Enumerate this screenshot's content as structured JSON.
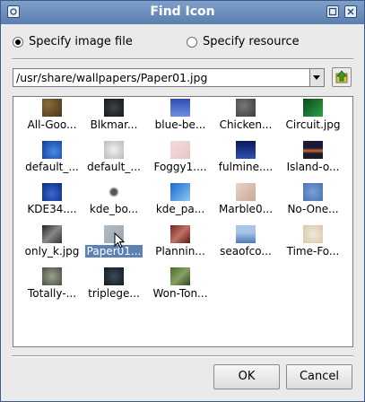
{
  "window": {
    "title": "Find Icon"
  },
  "source": {
    "file_label": "Specify image file",
    "resource_label": "Specify resource",
    "selected": "file"
  },
  "path": {
    "value": "/usr/share/wallpapers/Paper01.jpg"
  },
  "icons": [
    {
      "label": "All-Goo...",
      "thumb": "thumb-brown"
    },
    {
      "label": "Blkmar...",
      "thumb": "thumb-darkspeck"
    },
    {
      "label": "blue-be...",
      "thumb": "thumb-blue"
    },
    {
      "label": "Chicken...",
      "thumb": "thumb-greyrock"
    },
    {
      "label": "Circuit.jpg",
      "thumb": "thumb-circuit"
    },
    {
      "label": "default_...",
      "thumb": "thumb-default-blue"
    },
    {
      "label": "default_...",
      "thumb": "thumb-default-grey"
    },
    {
      "label": "Foggy1....",
      "thumb": "thumb-pink"
    },
    {
      "label": "fulmine....",
      "thumb": "thumb-navy"
    },
    {
      "label": "Island-o...",
      "thumb": "thumb-sunset"
    },
    {
      "label": "KDE34....",
      "thumb": "thumb-kde34"
    },
    {
      "label": "kde_bo...",
      "thumb": "thumb-kde-bo"
    },
    {
      "label": "kde_pa...",
      "thumb": "thumb-kde-pa"
    },
    {
      "label": "Marble0...",
      "thumb": "thumb-marble"
    },
    {
      "label": "No-One...",
      "thumb": "thumb-noone"
    },
    {
      "label": "only_k.jpg",
      "thumb": "thumb-onlyk"
    },
    {
      "label": "Paper01...",
      "thumb": "thumb-paper",
      "selected": true
    },
    {
      "label": "Plannin...",
      "thumb": "thumb-planning"
    },
    {
      "label": "seaofco...",
      "thumb": "thumb-sea"
    },
    {
      "label": "Time-Fo...",
      "thumb": "thumb-time"
    },
    {
      "label": "Totally-...",
      "thumb": "thumb-totally"
    },
    {
      "label": "triplege...",
      "thumb": "thumb-triple"
    },
    {
      "label": "Won-Ton...",
      "thumb": "thumb-wonton"
    }
  ],
  "buttons": {
    "ok": "OK",
    "cancel": "Cancel"
  },
  "colors": {
    "titlebar": "#6a8dbd",
    "selection": "#5c81b4"
  }
}
